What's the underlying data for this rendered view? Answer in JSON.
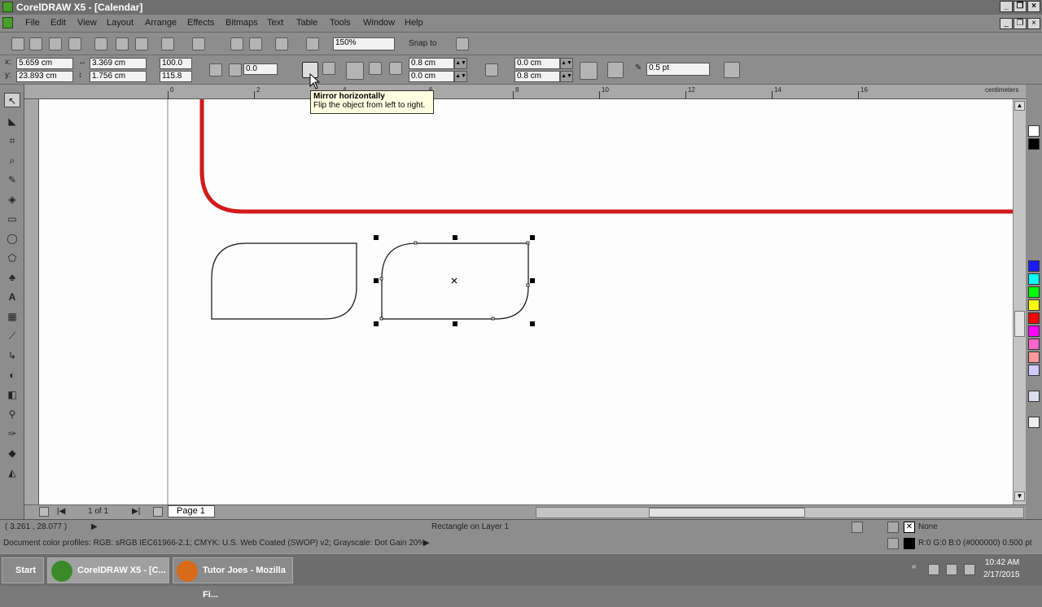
{
  "window": {
    "title": "CorelDRAW X5 - [Calendar]"
  },
  "menu": {
    "items": [
      "File",
      "Edit",
      "View",
      "Layout",
      "Arrange",
      "Effects",
      "Bitmaps",
      "Text",
      "Table",
      "Tools",
      "Window",
      "Help"
    ]
  },
  "standard_toolbar": {
    "zoom": "150%",
    "snap_label": "Snap to"
  },
  "property_bar": {
    "x": "5.659 cm",
    "y": "23.893 cm",
    "width": "3.369 cm",
    "height": "1.756 cm",
    "scale_x": "100.0",
    "scale_y": "115.8",
    "rotation": "0.0",
    "corner_top_left": "0.8 cm",
    "corner_bottom_left": "0.0 cm",
    "corner_top_right": "0.0 cm",
    "corner_bottom_right": "0.8 cm",
    "outline_width": "0.5 pt"
  },
  "tooltip": {
    "title": "Mirror horizontally",
    "body": "Flip the object from left to right."
  },
  "ruler": {
    "units": "centimeters",
    "h_labels": [
      "0",
      "2",
      "4",
      "6",
      "8",
      "10",
      "12",
      "14",
      "16"
    ]
  },
  "page_nav": {
    "counter": "1 of 1",
    "tab": "Page 1"
  },
  "status": {
    "coords": "( 3.261 , 28.077 )",
    "object_info": "Rectangle on Layer 1",
    "fill_label": "None",
    "outline_info": "R:0 G:0 B:0 (#000000)  0.500 pt",
    "color_profiles": "Document color profiles: RGB: sRGB IEC61966-2.1; CMYK: U.S. Web Coated (SWOP) v2; Grayscale: Dot Gain 20%"
  },
  "taskbar": {
    "start": "Start",
    "task1": "CorelDRAW X5 - [C...",
    "task2": "Tutor Joes - Mozilla Fi...",
    "time": "10:42 AM",
    "date": "2/17/2015"
  },
  "colors": {
    "red_stroke": "#d11a1a",
    "palette": [
      "#ffffff",
      "#000000",
      "#1a1aff",
      "#00ffff",
      "#00ff00",
      "#ffff00",
      "#ff0000",
      "#ff00ff",
      "#ff66cc",
      "#ff9999",
      "#ccccff",
      "#ddddee",
      "#eeeeee"
    ]
  }
}
